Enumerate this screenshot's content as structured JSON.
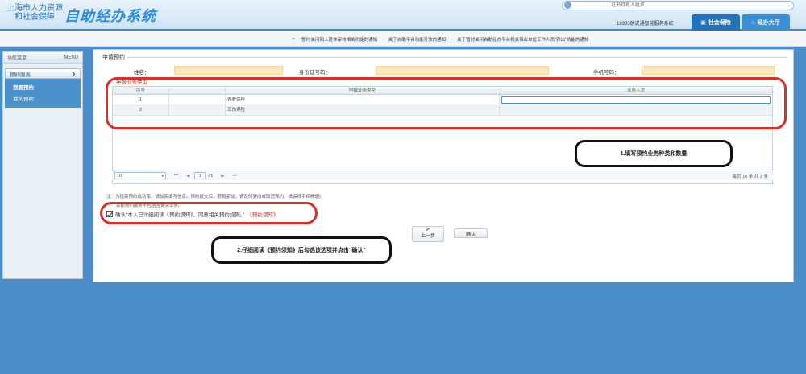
{
  "header": {
    "org_line1": "上海市人力资源",
    "org_line2": "和社会保障",
    "system_title": "自助经办系统",
    "search_placeholder": "证书持有人姓名",
    "hotline": "12333就说通智能服务系统",
    "nav_social": "社会保险",
    "nav_hall": "经办大厅"
  },
  "notices": [
    "“暂时关闭网上退休审核相关功能的通知",
    "关于自助平台功能开放的通知",
    "关于暂时关闭自助经办平台机关事业单位工作人员“转出”功能的通知"
  ],
  "sidebar": {
    "title": "导航菜单",
    "menu_label": "MENU",
    "group_label": "预约服务",
    "items": [
      {
        "label": "我要预约"
      },
      {
        "label": "我的预约"
      }
    ]
  },
  "form": {
    "section_title": "申请预约",
    "name_label": "姓名：",
    "id_label": "身份证号码：",
    "phone_label": "手机号码：",
    "business_type_label": "申报业务类型"
  },
  "grid": {
    "headers": [
      "序号",
      "",
      "申报业务类型",
      "业务人次"
    ],
    "rows": [
      {
        "seq": "1",
        "type": "养老保险",
        "qty": ""
      },
      {
        "seq": "2",
        "type": "工伤保险",
        "qty": ""
      }
    ]
  },
  "pager": {
    "page_size": "10",
    "current_page": "1",
    "total_pages": "/ 1",
    "summary": "每页 10 条,共 2 条"
  },
  "notes": {
    "note1": "注：为提高预约成功率，请如实填写信息。预约提交后，若有变动，请及时更改或取消预约，请保持手机畅通)",
    "note2": "目前预约服务不包括咨询类业务。",
    "confirm_text": "确认“本人已详细阅读《预约须知》，同意相关预约规则。”",
    "notice_link": "《预约须知》"
  },
  "buttons": {
    "prev": "上一步",
    "confirm": "确认"
  },
  "callouts": {
    "step1": "1.填写预约业务种类和数量",
    "step2": "2.仔细阅读《预约须知》后勾选该选项并点击“确认”"
  },
  "colors": {
    "header_blue": "#2f8de0",
    "page_blue": "#4a8dc8",
    "input_yellow": "#fbeac0",
    "annotation_red": "#d8302a"
  }
}
